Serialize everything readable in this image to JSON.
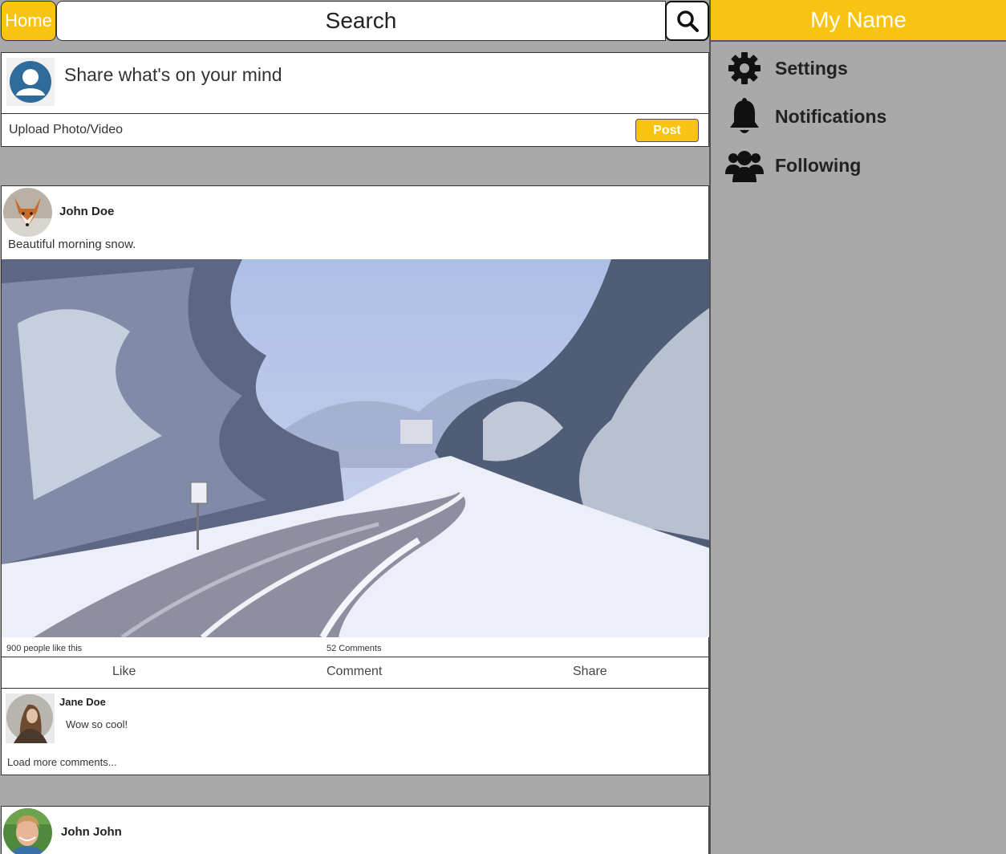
{
  "header": {
    "home_label": "Home",
    "search_label": "Search",
    "search_icon": "search-icon"
  },
  "sidebar": {
    "title": "My Name",
    "items": [
      {
        "label": "Settings",
        "icon": "gear-icon"
      },
      {
        "label": "Notifications",
        "icon": "bell-icon"
      },
      {
        "label": "Following",
        "icon": "users-icon"
      }
    ]
  },
  "composer": {
    "prompt": "Share what's on your mind",
    "upload_label": "Upload Photo/Video",
    "post_label": "Post"
  },
  "feed": {
    "post1": {
      "author": "John Doe",
      "caption": "Beautiful morning snow.",
      "likes": "900 people like this",
      "comments_count": "52 Comments",
      "actions": {
        "like": "Like",
        "comment": "Comment",
        "share": "Share"
      },
      "comment": {
        "author": "Jane Doe",
        "text": "Wow so cool!"
      },
      "load_more": "Load more comments..."
    },
    "post2": {
      "author": "John John"
    }
  },
  "colors": {
    "accent": "#f8c311",
    "background": "#a9a9a9",
    "avatar_blue": "#2f6b9a"
  }
}
